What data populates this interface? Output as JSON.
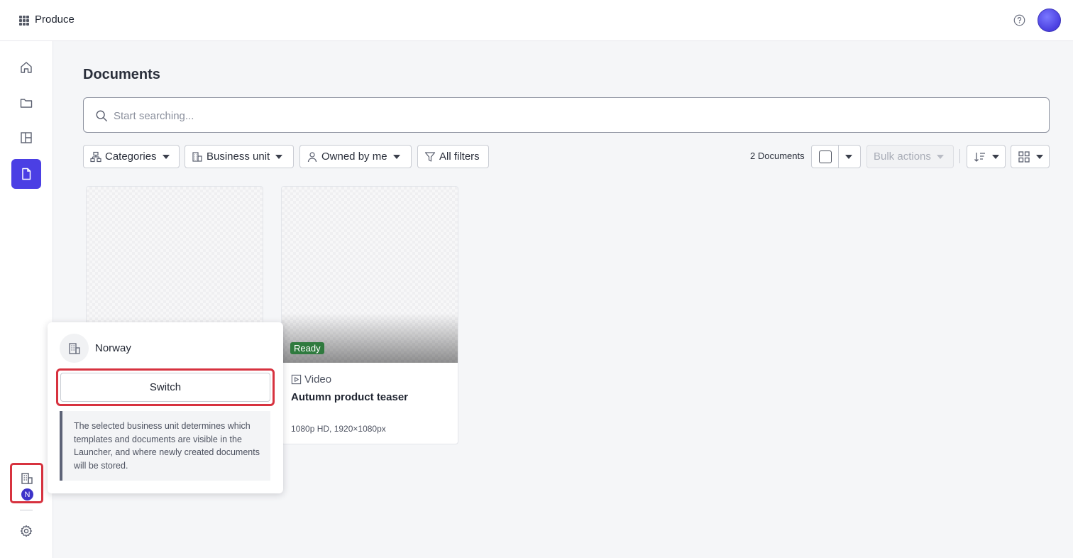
{
  "header": {
    "app_title": "Produce",
    "apps_icon": "grid-dots-icon",
    "help_icon": "help-icon",
    "avatar_color": "#5148e8"
  },
  "sidebar": {
    "items": [
      {
        "id": "home",
        "icon": "home-icon"
      },
      {
        "id": "folders",
        "icon": "folder-icon"
      },
      {
        "id": "templates",
        "icon": "layout-icon"
      },
      {
        "id": "documents",
        "icon": "document-icon",
        "active": true
      }
    ],
    "business_unit": {
      "icon": "building-icon",
      "badge": "N"
    },
    "settings": {
      "icon": "gear-icon"
    },
    "accent_color": "#4b3fe4",
    "highlight_color": "#d7323f"
  },
  "main": {
    "title": "Documents",
    "search": {
      "placeholder": "Start searching...",
      "value": ""
    },
    "filters": [
      {
        "label": "Categories",
        "icon": "category-tree-icon"
      },
      {
        "label": "Business unit",
        "icon": "building-icon"
      },
      {
        "label": "Owned by me",
        "icon": "user-icon"
      },
      {
        "label": "All filters",
        "icon": "filter-icon"
      }
    ],
    "toolbar": {
      "count": "2 Documents",
      "bulk_actions_label": "Bulk actions",
      "sort_icon": "sort-icon",
      "view_icon": "grid-view-icon"
    },
    "cards": [
      {
        "name": "",
        "type": "",
        "meta": "",
        "status": ""
      },
      {
        "name": "Autumn product teaser",
        "type": "Video",
        "meta": "1080p HD, 1920×1080px",
        "status": "Ready",
        "status_color": "#2f7a3e"
      }
    ]
  },
  "popover": {
    "unit_name": "Norway",
    "switch_label": "Switch",
    "info": "The selected business unit determines which templates and documents are visible in the Launcher, and where newly created documents will be stored."
  }
}
